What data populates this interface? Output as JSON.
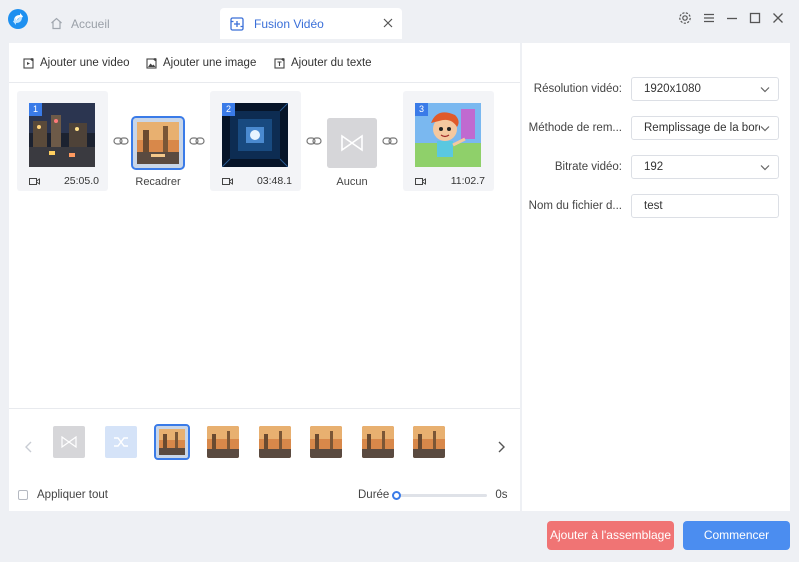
{
  "titlebar": {
    "home_tab": "Accueil",
    "active_tab": "Fusion Vidéo"
  },
  "toolbar": {
    "add_video": "Ajouter une video",
    "add_image": "Ajouter une image",
    "add_text": "Ajouter du texte"
  },
  "clips": [
    {
      "index": "1",
      "duration": "25:05.0"
    },
    {
      "index": "2",
      "duration": "03:48.1"
    },
    {
      "index": "3",
      "duration": "11:02.7"
    }
  ],
  "transitions": [
    {
      "label": "Recadrer"
    },
    {
      "label": "Aucun"
    }
  ],
  "bottom": {
    "apply_all": "Appliquer tout",
    "duration_label": "Durée",
    "duration_value": "0s",
    "duration_fraction": 0
  },
  "settings": {
    "resolution_label": "Résolution vidéo:",
    "resolution_value": "1920x1080",
    "method_label": "Méthode de rem...",
    "method_value": "Remplissage de la bord",
    "bitrate_label": "Bitrate vidéo:",
    "bitrate_value": "192",
    "filename_label": "Nom du fichier d...",
    "filename_value": "test"
  },
  "actions": {
    "add_to_assembly": "Ajouter à l'assemblage",
    "start": "Commencer"
  },
  "colors": {
    "accent": "#3a7be8",
    "add_button": "#f07474",
    "start_button": "#4b8df0"
  }
}
